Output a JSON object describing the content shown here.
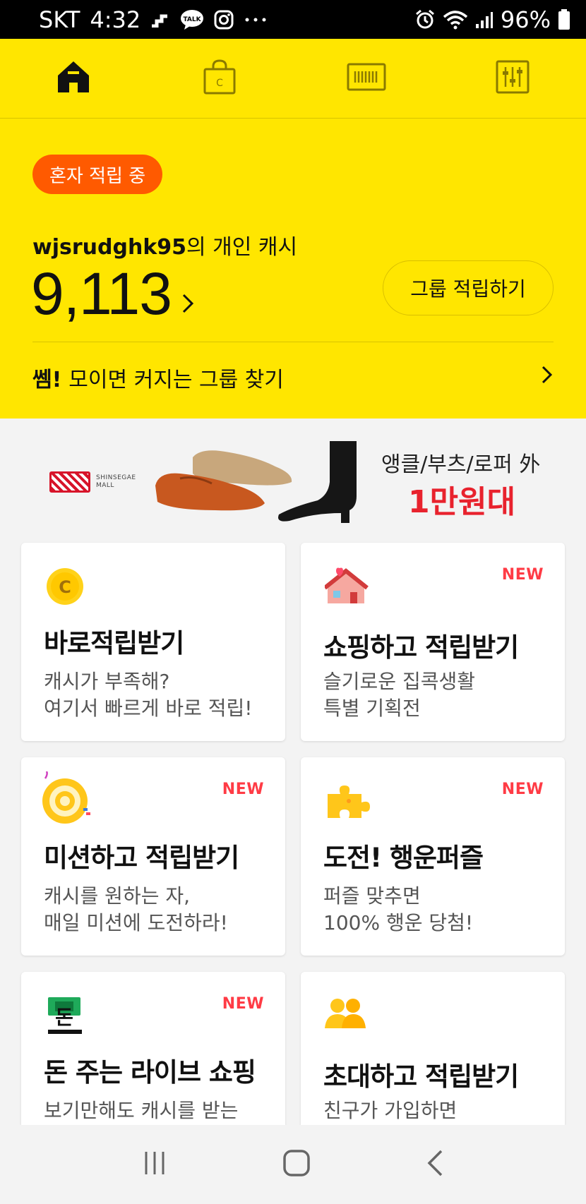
{
  "status_bar": {
    "carrier": "SKT",
    "time": "4:32",
    "battery": "96%"
  },
  "top_nav": {
    "tabs": [
      "home",
      "shopping",
      "barcode",
      "settings"
    ],
    "active": "home"
  },
  "cash": {
    "badge": "혼자 적립 중",
    "owner_name": "wjsrudghk95",
    "owner_suffix": "의 개인 캐시",
    "amount": "9,113",
    "group_button": "그룹 적립하기",
    "find_bold": "쎔!",
    "find_text": "모이면 커지는 그룹 찾기"
  },
  "banner": {
    "logo_text": "SHINSEGAE MALL",
    "line1": "앵클/부츠/로퍼 外",
    "line2": "1만원대"
  },
  "cards": [
    {
      "title": "바로적립받기",
      "desc1": "캐시가 부족해?",
      "desc2": "여기서 빠르게 바로 적립!",
      "new": "",
      "icon": "coin-icon"
    },
    {
      "title": "쇼핑하고 적립받기",
      "desc1": "슬기로운 집콕생활",
      "desc2": "특별 기획전",
      "new": "NEW",
      "icon": "house-icon"
    },
    {
      "title": "미션하고 적립받기",
      "desc1": "캐시를 원하는 자,",
      "desc2": "매일 미션에 도전하라!",
      "new": "NEW",
      "icon": "target-icon"
    },
    {
      "title": "도전! 행운퍼즐",
      "desc1": "퍼즐 맞추면",
      "desc2": "100% 행운 당첨!",
      "new": "NEW",
      "icon": "puzzle-icon"
    },
    {
      "title": "돈 주는 라이브 쇼핑",
      "desc1": "보기만해도 캐시를 받는",
      "desc2": "",
      "new": "NEW",
      "icon": "money-icon"
    },
    {
      "title": "초대하고 적립받기",
      "desc1": "친구가 가입하면",
      "desc2": "",
      "new": "",
      "icon": "friends-icon"
    }
  ],
  "colors": {
    "brand_yellow": "#ffe600",
    "badge_orange": "#ff5a00",
    "new_red": "#ff3b45"
  }
}
